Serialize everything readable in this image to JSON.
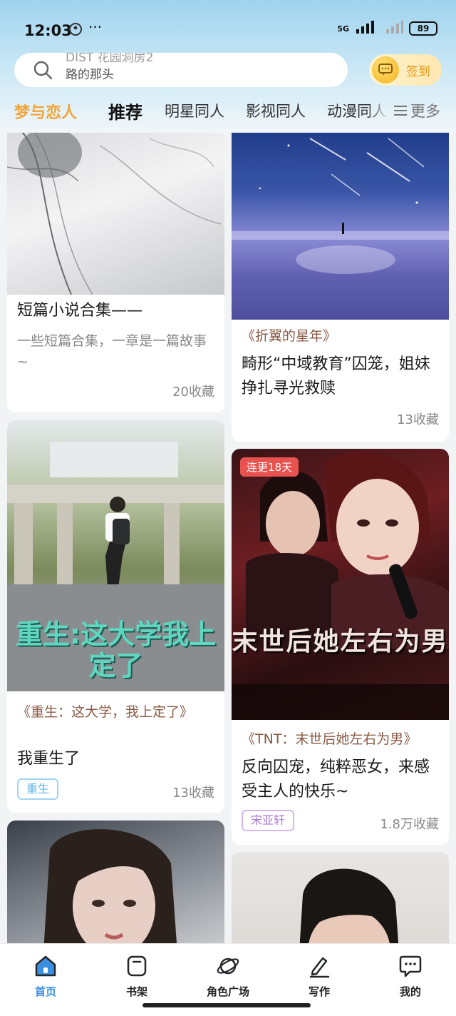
{
  "status_bar": {
    "time": "12:03",
    "dots": "···",
    "network": "5G",
    "battery": "89"
  },
  "search": {
    "faded_text": "DIST 花园洞房2",
    "placeholder": "路的那头"
  },
  "signin": {
    "label": "签到"
  },
  "tabs": [
    "梦与恋人",
    "推荐",
    "明星同人",
    "影视同人",
    "动漫同人",
    "更多"
  ],
  "feed": {
    "left": [
      {
        "title": "短篇小说合集——",
        "desc": "一些短篇合集，一章是一篇故事~",
        "favorites": "20收藏"
      },
      {
        "cover_text": "重生:这大学我上定了",
        "book": "《重生：这大学，我上定了》",
        "title": "我重生了",
        "tag": "重生",
        "favorites": "13收藏"
      },
      {
        "title": ""
      }
    ],
    "right": [
      {
        "book": "《折翼的星年》",
        "title": "畸形“中域教育”囚笼，姐妹挣扎寻光救赎",
        "favorites": "13收藏"
      },
      {
        "badge": "连更18天",
        "cover_text": "末世后她左右为男",
        "book": "《TNT：末世后她左右为男》",
        "title": "反向囚宠，纯粹恶女，来感受主人的快乐~",
        "tag": "宋亚轩",
        "favorites": "1.8万收藏"
      },
      {
        "title": ""
      }
    ]
  },
  "bottom_nav": [
    "首页",
    "书架",
    "角色广场",
    "写作",
    "我的"
  ],
  "colors": {
    "accent": "#3b8fe0",
    "brand_tab": "#f0a53a",
    "badge": "#e9534f",
    "tag_blue": "#5db4e8",
    "tag_purple": "#b889e0"
  }
}
